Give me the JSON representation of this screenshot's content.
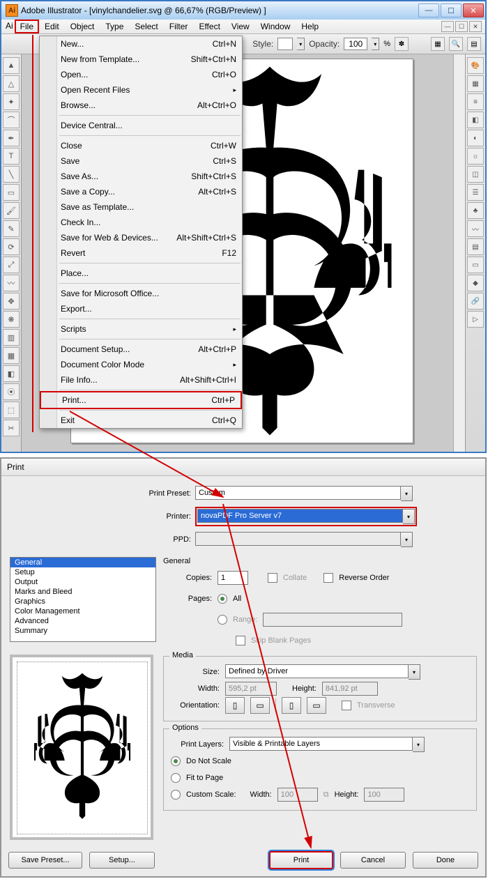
{
  "titlebar": {
    "app_icon_text": "Ai",
    "title": "Adobe Illustrator - [vinylchandelier.svg @ 66,67% (RGB/Preview) ]"
  },
  "menubar": {
    "items": [
      "File",
      "Edit",
      "Object",
      "Type",
      "Select",
      "Filter",
      "Effect",
      "View",
      "Window",
      "Help"
    ]
  },
  "optionsbar": {
    "style_label": "Style:",
    "opacity_label": "Opacity:",
    "opacity_value": "100",
    "percent": "%"
  },
  "file_menu": [
    {
      "label": "New...",
      "shortcut": "Ctrl+N"
    },
    {
      "label": "New from Template...",
      "shortcut": "Shift+Ctrl+N"
    },
    {
      "label": "Open...",
      "shortcut": "Ctrl+O"
    },
    {
      "label": "Open Recent Files",
      "submenu": true
    },
    {
      "label": "Browse...",
      "shortcut": "Alt+Ctrl+O"
    },
    {
      "sep": true
    },
    {
      "label": "Device Central..."
    },
    {
      "sep": true
    },
    {
      "label": "Close",
      "shortcut": "Ctrl+W"
    },
    {
      "label": "Save",
      "shortcut": "Ctrl+S"
    },
    {
      "label": "Save As...",
      "shortcut": "Shift+Ctrl+S"
    },
    {
      "label": "Save a Copy...",
      "shortcut": "Alt+Ctrl+S"
    },
    {
      "label": "Save as Template..."
    },
    {
      "label": "Check In..."
    },
    {
      "label": "Save for Web & Devices...",
      "shortcut": "Alt+Shift+Ctrl+S"
    },
    {
      "label": "Revert",
      "shortcut": "F12"
    },
    {
      "sep": true
    },
    {
      "label": "Place..."
    },
    {
      "sep": true
    },
    {
      "label": "Save for Microsoft Office..."
    },
    {
      "label": "Export..."
    },
    {
      "sep": true
    },
    {
      "label": "Scripts",
      "submenu": true
    },
    {
      "sep": true
    },
    {
      "label": "Document Setup...",
      "shortcut": "Alt+Ctrl+P"
    },
    {
      "label": "Document Color Mode",
      "submenu": true
    },
    {
      "label": "File Info...",
      "shortcut": "Alt+Shift+Ctrl+I"
    },
    {
      "sep": true
    },
    {
      "label": "Print...",
      "shortcut": "Ctrl+P",
      "highlight": true
    },
    {
      "sep": true
    },
    {
      "label": "Exit",
      "shortcut": "Ctrl+Q"
    }
  ],
  "print_dialog": {
    "title": "Print",
    "preset_label": "Print Preset:",
    "preset_value": "Custom",
    "printer_label": "Printer:",
    "printer_value": "novaPDF Pro Server v7",
    "ppd_label": "PPD:",
    "ppd_value": "",
    "categories": [
      "General",
      "Setup",
      "Output",
      "Marks and Bleed",
      "Graphics",
      "Color Management",
      "Advanced",
      "Summary"
    ],
    "general": {
      "legend": "General",
      "copies_label": "Copies:",
      "copies_value": "1",
      "collate_label": "Collate",
      "reverse_label": "Reverse Order",
      "pages_label": "Pages:",
      "all_label": "All",
      "range_label": "Range:",
      "range_value": "",
      "skip_label": "Skip Blank Pages"
    },
    "media": {
      "legend": "Media",
      "size_label": "Size:",
      "size_value": "Defined by Driver",
      "width_label": "Width:",
      "width_value": "595,2 pt",
      "height_label": "Height:",
      "height_value": "841,92 pt",
      "orientation_label": "Orientation:",
      "transverse_label": "Transverse"
    },
    "options": {
      "legend": "Options",
      "layers_label": "Print Layers:",
      "layers_value": "Visible & Printable Layers",
      "dns_label": "Do Not Scale",
      "fit_label": "Fit to Page",
      "custom_label": "Custom Scale:",
      "cw_label": "Width:",
      "cw_value": "100",
      "ch_label": "Height:",
      "ch_value": "100"
    },
    "buttons": {
      "save_preset": "Save Preset...",
      "setup": "Setup...",
      "print": "Print",
      "cancel": "Cancel",
      "done": "Done"
    }
  },
  "icons": {
    "minimize": "—",
    "maximize": "☐",
    "close": "✕",
    "triangle_down": "▾",
    "triangle_right": "▸",
    "portrait": "▯",
    "landscape": "▭",
    "link": "⧉"
  }
}
